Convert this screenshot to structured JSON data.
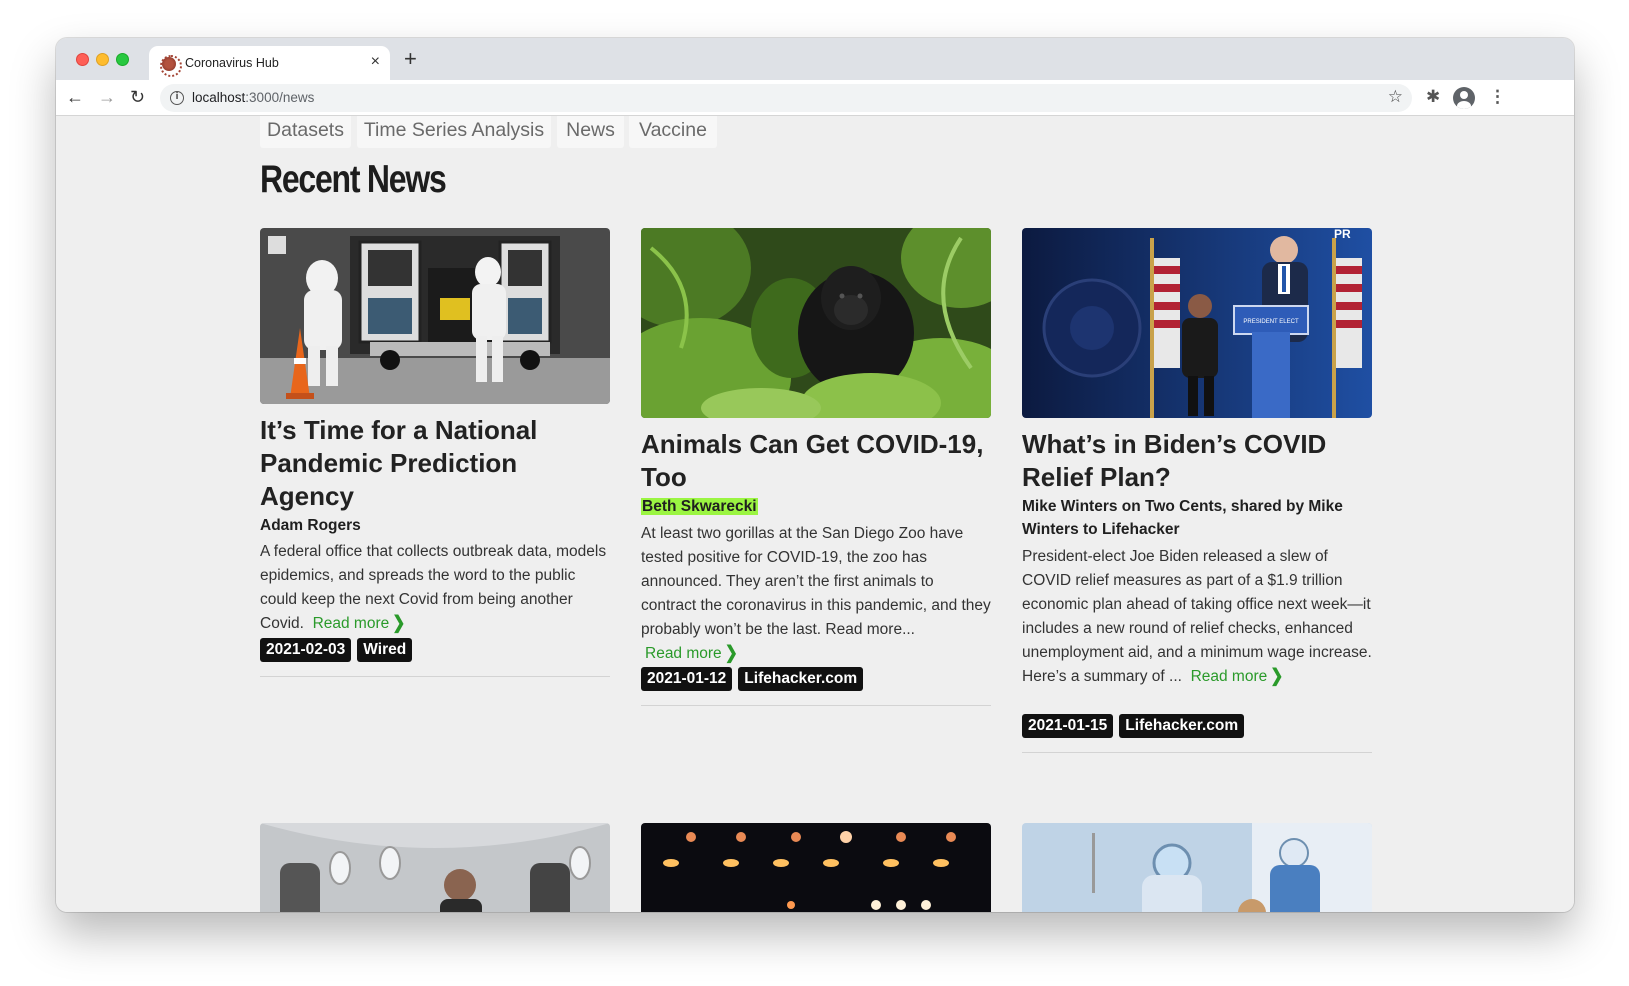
{
  "browser": {
    "tab_title": "Coronavirus Hub",
    "tab_close": "×",
    "new_tab": "+",
    "url_host": "localhost",
    "url_path": ":3000/news",
    "info_icon_glyph": "i",
    "back_glyph": "←",
    "forward_glyph": "→",
    "reload_glyph": "↻",
    "star_glyph": "☆",
    "extensions_glyph": "✱",
    "menu_glyph": "⋮"
  },
  "nav": {
    "tabs": [
      {
        "label": "Datasets"
      },
      {
        "label": "Time Series Analysis"
      },
      {
        "label": "News"
      },
      {
        "label": "Vaccine"
      }
    ]
  },
  "page": {
    "title": "Recent News",
    "read_more_label": "Read more",
    "chevron_glyph": "❯"
  },
  "articles": [
    {
      "title": "It’s Time for a National Pandemic Prediction Agency",
      "author": "Adam Rogers",
      "author_highlighted": false,
      "description": "A federal office that collects outbreak data, models epidemics, and spreads the word to the public could keep the next Covid from being another Covid.",
      "date": "2021-02-03",
      "source": "Wired",
      "image_icon": "ambulance-photo-icon"
    },
    {
      "title": "Animals Can Get COVID-19, Too",
      "author": "Beth Skwarecki",
      "author_highlighted": true,
      "description": "At least two gorillas at the San Diego Zoo have tested positive for COVID-19, the zoo has announced. They aren’t the first animals to contract the coronavirus in this pandemic, and they probably won’t be the last. Read more...",
      "date": "2021-01-12",
      "source": "Lifehacker.com",
      "image_icon": "gorilla-photo-icon"
    },
    {
      "title": "What’s in Biden’s COVID Relief Plan?",
      "author": "Mike Winters on Two Cents, shared by Mike Winters to Lifehacker",
      "author_highlighted": false,
      "description": "President-elect Joe Biden released a slew of COVID relief measures as part of a $1.9 trillion economic plan ahead of taking office next week—it includes a new round of relief checks, enhanced unemployment aid, and a minimum wage increase. Here’s a summary of ...",
      "date": "2021-01-15",
      "source": "Lifehacker.com",
      "image_icon": "press-conference-photo-icon",
      "image_text": "PR",
      "podium_text": "PRESIDENT ELECT"
    }
  ],
  "colors": {
    "read_more": "#2a9a2a",
    "author_highlight": "#9bf542",
    "badge_bg": "#111111"
  }
}
